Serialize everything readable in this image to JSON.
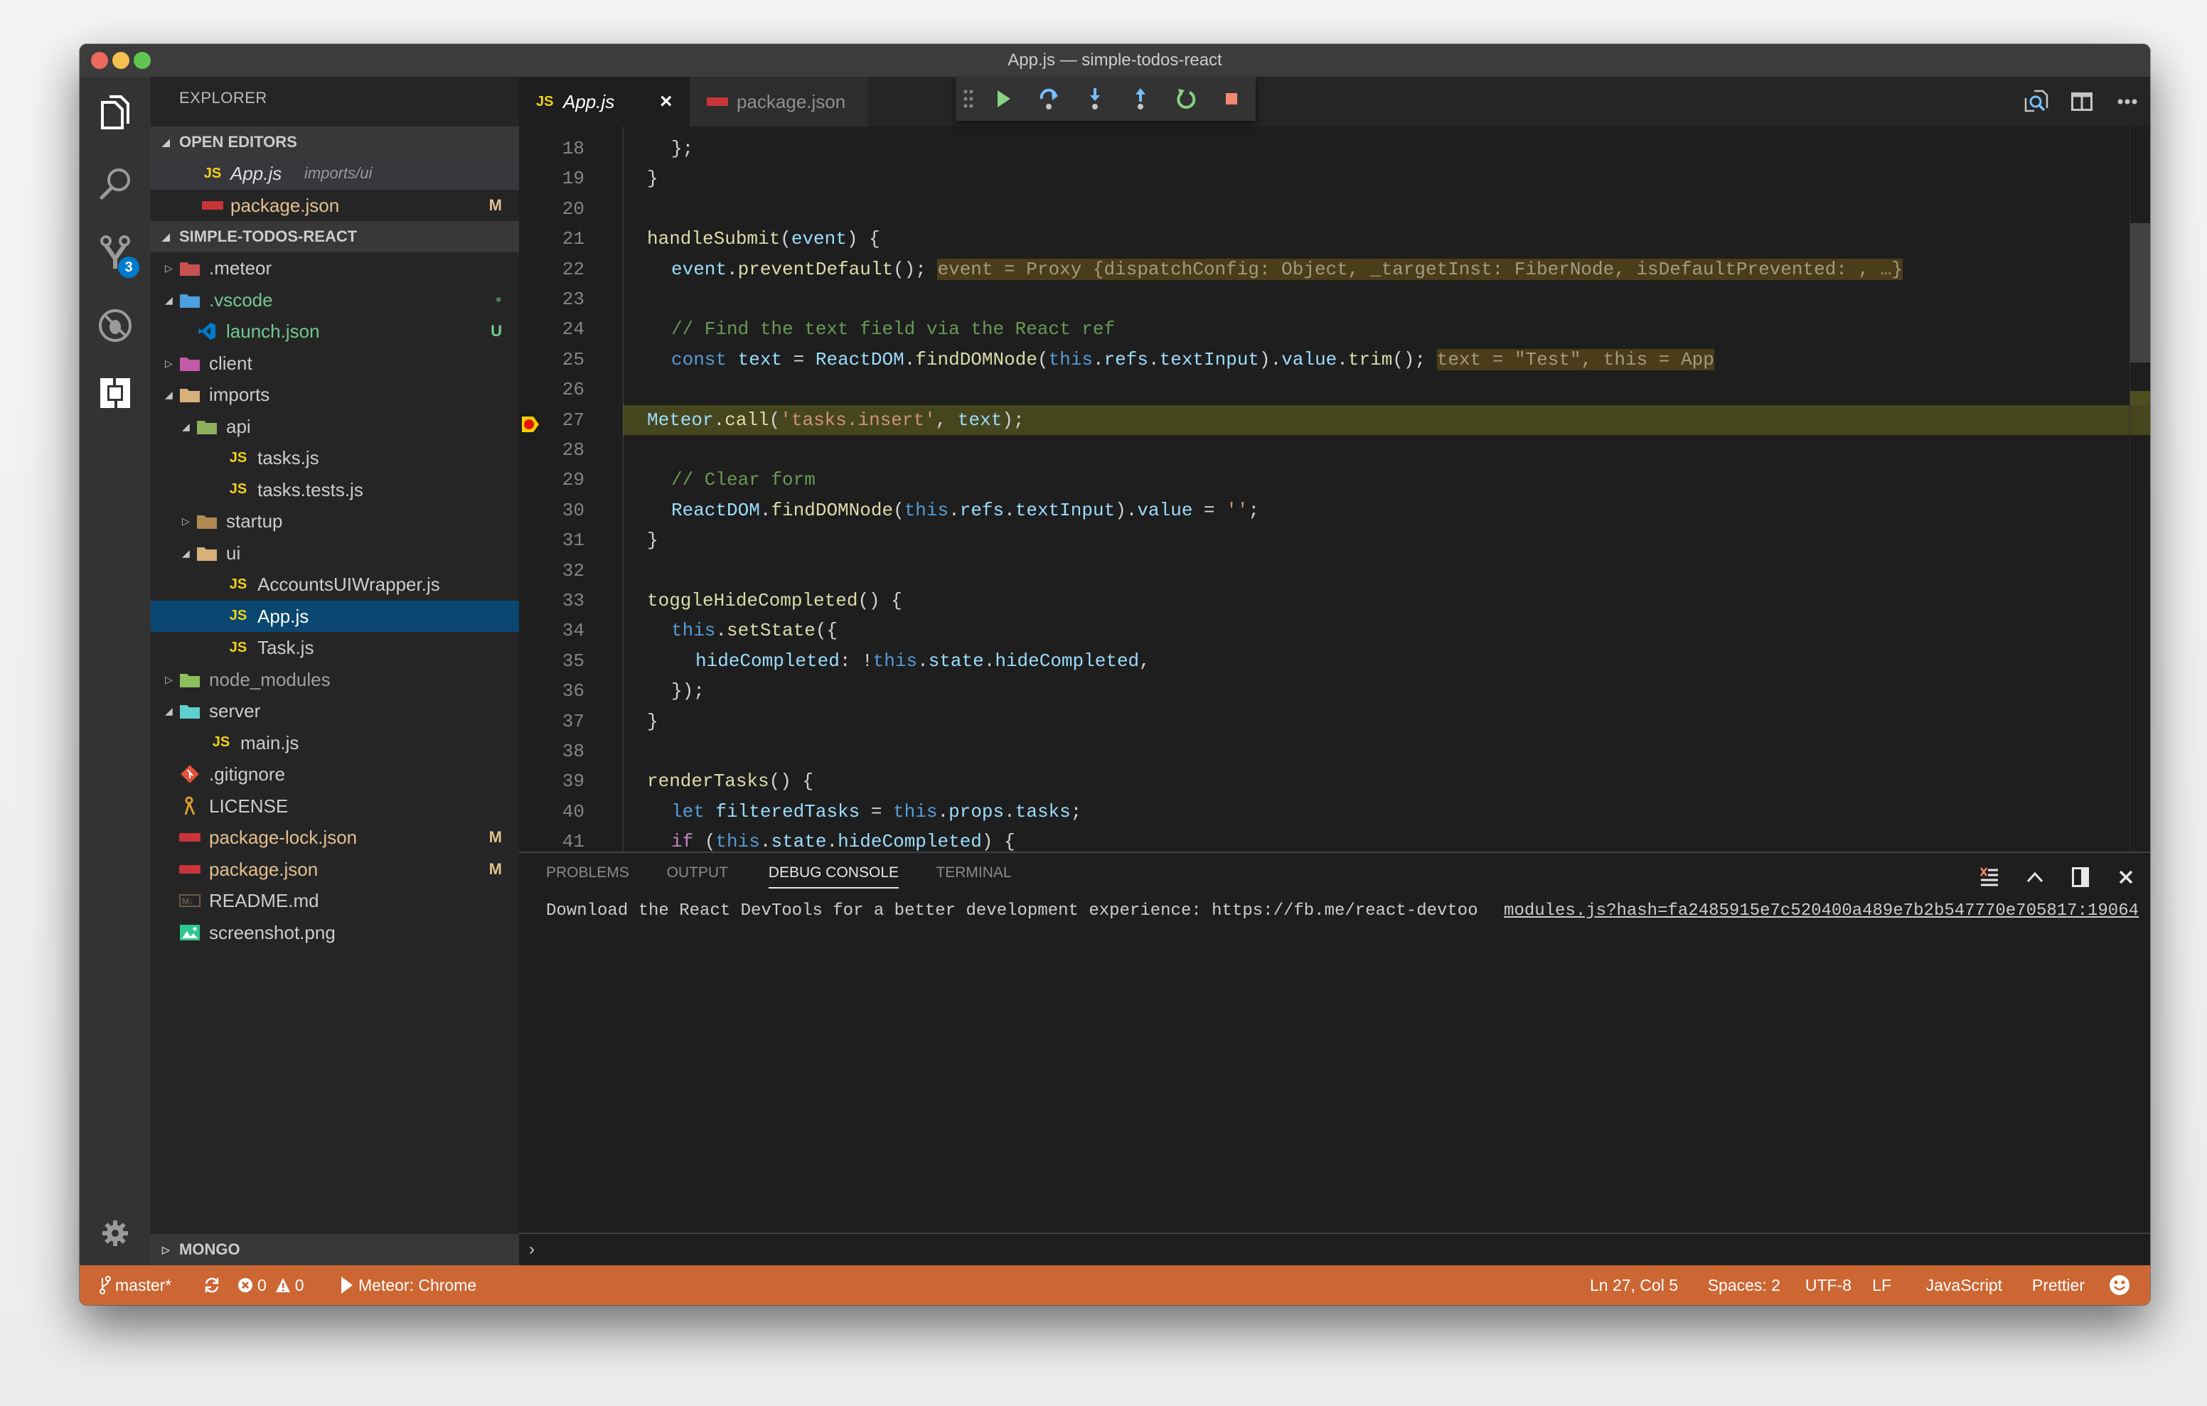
{
  "window": {
    "title": "App.js — simple-todos-react"
  },
  "activity_bar": {
    "items": [
      {
        "name": "explorer",
        "icon": "files-icon"
      },
      {
        "name": "search",
        "icon": "search-icon"
      },
      {
        "name": "source-control",
        "icon": "git-branch-icon",
        "badge": "3"
      },
      {
        "name": "debug",
        "icon": "debug-disabled-icon"
      },
      {
        "name": "extensions",
        "icon": "extensions-icon"
      }
    ],
    "settings_icon": "gear-icon"
  },
  "sidebar": {
    "title": "EXPLORER",
    "open_editors": {
      "label": "OPEN EDITORS",
      "items": [
        {
          "name": "App.js",
          "path": "imports/ui",
          "icon": "js"
        },
        {
          "name": "package.json",
          "git": "M",
          "icon": "npm"
        }
      ]
    },
    "project": {
      "label": "SIMPLE-TODOS-REACT",
      "items": [
        {
          "name": ".meteor",
          "depth": 0,
          "type": "folder",
          "expanded": false,
          "icon": "meteor-folder"
        },
        {
          "name": ".vscode",
          "depth": 0,
          "type": "folder",
          "expanded": true,
          "icon": "vscode-folder",
          "git": "●"
        },
        {
          "name": "launch.json",
          "depth": 1,
          "type": "file",
          "icon": "vscode",
          "git": "U"
        },
        {
          "name": "client",
          "depth": 0,
          "type": "folder",
          "expanded": false,
          "icon": "client-folder"
        },
        {
          "name": "imports",
          "depth": 0,
          "type": "folder",
          "expanded": true,
          "icon": "folder-open"
        },
        {
          "name": "api",
          "depth": 1,
          "type": "folder",
          "expanded": true,
          "icon": "api-folder"
        },
        {
          "name": "tasks.js",
          "depth": 2,
          "type": "file",
          "icon": "js"
        },
        {
          "name": "tasks.tests.js",
          "depth": 2,
          "type": "file",
          "icon": "js"
        },
        {
          "name": "startup",
          "depth": 1,
          "type": "folder",
          "expanded": false,
          "icon": "folder"
        },
        {
          "name": "ui",
          "depth": 1,
          "type": "folder",
          "expanded": true,
          "icon": "folder-open"
        },
        {
          "name": "AccountsUIWrapper.js",
          "depth": 2,
          "type": "file",
          "icon": "js"
        },
        {
          "name": "App.js",
          "depth": 2,
          "type": "file",
          "icon": "js",
          "selected": true
        },
        {
          "name": "Task.js",
          "depth": 2,
          "type": "file",
          "icon": "js"
        },
        {
          "name": "node_modules",
          "depth": 0,
          "type": "folder",
          "expanded": false,
          "icon": "node-folder"
        },
        {
          "name": "server",
          "depth": 0,
          "type": "folder",
          "expanded": true,
          "icon": "server-folder"
        },
        {
          "name": "main.js",
          "depth": 1,
          "type": "file",
          "icon": "js"
        },
        {
          "name": ".gitignore",
          "depth": 0,
          "type": "file",
          "icon": "git"
        },
        {
          "name": "LICENSE",
          "depth": 0,
          "type": "file",
          "icon": "key"
        },
        {
          "name": "package-lock.json",
          "depth": 0,
          "type": "file",
          "icon": "npm",
          "git": "M"
        },
        {
          "name": "package.json",
          "depth": 0,
          "type": "file",
          "icon": "npm",
          "git": "M"
        },
        {
          "name": "README.md",
          "depth": 0,
          "type": "file",
          "icon": "markdown"
        },
        {
          "name": "screenshot.png",
          "depth": 0,
          "type": "file",
          "icon": "image"
        }
      ]
    },
    "mongo": {
      "label": "MONGO"
    }
  },
  "tabs": [
    {
      "label": "App.js",
      "icon": "JS",
      "active": true,
      "close": "×"
    },
    {
      "label": "package.json",
      "icon": "npm",
      "active": false
    }
  ],
  "debug_toolbar": [
    "drag-handle",
    "continue",
    "step-over",
    "step-into",
    "step-out",
    "restart",
    "stop"
  ],
  "editor_actions": [
    "open-changes",
    "split-editor",
    "more"
  ],
  "code": {
    "current_line": 27,
    "breakpoint_line": 27,
    "lines": [
      {
        "n": "18",
        "indent": 2,
        "tokens": [
          [
            "p",
            "};"
          ]
        ]
      },
      {
        "n": "19",
        "indent": 1,
        "tokens": [
          [
            "p",
            "}"
          ]
        ]
      },
      {
        "n": "20",
        "indent": 0,
        "tokens": []
      },
      {
        "n": "21",
        "indent": 1,
        "tokens": [
          [
            "f",
            "handleSubmit"
          ],
          [
            "p",
            "("
          ],
          [
            "v",
            "event"
          ],
          [
            "p",
            ") {"
          ]
        ]
      },
      {
        "n": "22",
        "indent": 2,
        "tokens": [
          [
            "v",
            "event"
          ],
          [
            "p",
            "."
          ],
          [
            "f",
            "preventDefault"
          ],
          [
            "p",
            "(); "
          ]
        ],
        "inline": "event = Proxy {dispatchConfig: Object, _targetInst: FiberNode, isDefaultPrevented: , …}"
      },
      {
        "n": "23",
        "indent": 0,
        "tokens": []
      },
      {
        "n": "24",
        "indent": 2,
        "tokens": [
          [
            "c",
            "// Find the text field via the React ref"
          ]
        ]
      },
      {
        "n": "25",
        "indent": 2,
        "tokens": [
          [
            "k",
            "const "
          ],
          [
            "v",
            "text"
          ],
          [
            "p",
            " = "
          ],
          [
            "v",
            "ReactDOM"
          ],
          [
            "p",
            "."
          ],
          [
            "f",
            "findDOMNode"
          ],
          [
            "p",
            "("
          ],
          [
            "k",
            "this"
          ],
          [
            "p",
            "."
          ],
          [
            "v",
            "refs"
          ],
          [
            "p",
            "."
          ],
          [
            "v",
            "textInput"
          ],
          [
            "p",
            ")."
          ],
          [
            "v",
            "value"
          ],
          [
            "p",
            "."
          ],
          [
            "f",
            "trim"
          ],
          [
            "p",
            "(); "
          ]
        ],
        "inline": "text = \"Test\", this = App"
      },
      {
        "n": "26",
        "indent": 0,
        "tokens": []
      },
      {
        "n": "27",
        "indent": 2,
        "tokens": [
          [
            "v",
            "Meteor"
          ],
          [
            "p",
            "."
          ],
          [
            "f",
            "call"
          ],
          [
            "p",
            "("
          ],
          [
            "s",
            "'tasks.insert'"
          ],
          [
            "p",
            ", "
          ],
          [
            "v",
            "text"
          ],
          [
            "p",
            ");"
          ]
        ]
      },
      {
        "n": "28",
        "indent": 0,
        "tokens": []
      },
      {
        "n": "29",
        "indent": 2,
        "tokens": [
          [
            "c",
            "// Clear form"
          ]
        ]
      },
      {
        "n": "30",
        "indent": 2,
        "tokens": [
          [
            "v",
            "ReactDOM"
          ],
          [
            "p",
            "."
          ],
          [
            "f",
            "findDOMNode"
          ],
          [
            "p",
            "("
          ],
          [
            "k",
            "this"
          ],
          [
            "p",
            "."
          ],
          [
            "v",
            "refs"
          ],
          [
            "p",
            "."
          ],
          [
            "v",
            "textInput"
          ],
          [
            "p",
            ")."
          ],
          [
            "v",
            "value"
          ],
          [
            "p",
            " = "
          ],
          [
            "s",
            "''"
          ],
          [
            "p",
            ";"
          ]
        ]
      },
      {
        "n": "31",
        "indent": 1,
        "tokens": [
          [
            "p",
            "}"
          ]
        ]
      },
      {
        "n": "32",
        "indent": 0,
        "tokens": []
      },
      {
        "n": "33",
        "indent": 1,
        "tokens": [
          [
            "f",
            "toggleHideCompleted"
          ],
          [
            "p",
            "() {"
          ]
        ]
      },
      {
        "n": "34",
        "indent": 2,
        "tokens": [
          [
            "k",
            "this"
          ],
          [
            "p",
            "."
          ],
          [
            "f",
            "setState"
          ],
          [
            "p",
            "({"
          ]
        ]
      },
      {
        "n": "35",
        "indent": 3,
        "tokens": [
          [
            "v",
            "hideCompleted"
          ],
          [
            "p",
            ": !"
          ],
          [
            "k",
            "this"
          ],
          [
            "p",
            "."
          ],
          [
            "v",
            "state"
          ],
          [
            "p",
            "."
          ],
          [
            "v",
            "hideCompleted"
          ],
          [
            "p",
            ","
          ]
        ]
      },
      {
        "n": "36",
        "indent": 2,
        "tokens": [
          [
            "p",
            "});"
          ]
        ]
      },
      {
        "n": "37",
        "indent": 1,
        "tokens": [
          [
            "p",
            "}"
          ]
        ]
      },
      {
        "n": "38",
        "indent": 0,
        "tokens": []
      },
      {
        "n": "39",
        "indent": 1,
        "tokens": [
          [
            "f",
            "renderTasks"
          ],
          [
            "p",
            "() {"
          ]
        ]
      },
      {
        "n": "40",
        "indent": 2,
        "tokens": [
          [
            "k",
            "let "
          ],
          [
            "v",
            "filteredTasks"
          ],
          [
            "p",
            " = "
          ],
          [
            "k",
            "this"
          ],
          [
            "p",
            "."
          ],
          [
            "v",
            "props"
          ],
          [
            "p",
            "."
          ],
          [
            "v",
            "tasks"
          ],
          [
            "p",
            ";"
          ]
        ]
      },
      {
        "n": "41",
        "indent": 2,
        "tokens": [
          [
            "kw",
            "if "
          ],
          [
            "p",
            "("
          ],
          [
            "k",
            "this"
          ],
          [
            "p",
            "."
          ],
          [
            "v",
            "state"
          ],
          [
            "p",
            "."
          ],
          [
            "v",
            "hideCompleted"
          ],
          [
            "p",
            ") {"
          ]
        ]
      }
    ]
  },
  "panel": {
    "tabs": [
      {
        "label": "PROBLEMS",
        "active": false
      },
      {
        "label": "OUTPUT",
        "active": false
      },
      {
        "label": "DEBUG CONSOLE",
        "active": true
      },
      {
        "label": "TERMINAL",
        "active": false
      }
    ],
    "console_message": "Download the React DevTools for a better development experience: https://fb.me/react-devtoo",
    "console_source": "modules.js?hash=fa2485915e7c520400a489e7b2b547770e705817:19064",
    "repl_prompt": "›"
  },
  "status_bar": {
    "branch": "master*",
    "errors": "0",
    "warnings": "0",
    "debug_config": "Meteor: Chrome",
    "position": "Ln 27, Col 5",
    "spaces": "Spaces: 2",
    "encoding": "UTF-8",
    "eol": "LF",
    "language": "JavaScript",
    "formatter": "Prettier",
    "background_color": "#cc6633"
  },
  "colors": {
    "accent": "#007acc",
    "selection": "#094771",
    "status_bar": "#cc6633"
  }
}
